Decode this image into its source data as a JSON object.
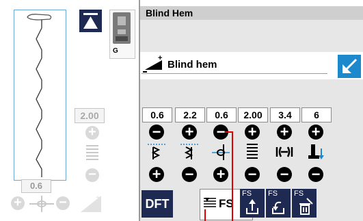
{
  "left_panel": {
    "width_value": "2.00",
    "position_value": "0.6"
  },
  "foot": {
    "label": "G"
  },
  "header": {
    "title": "Blind Hem"
  },
  "stitch": {
    "name": "Blind hem"
  },
  "settings": {
    "values": [
      "0.6",
      "2.2",
      "0.6",
      "2.00",
      "3.4",
      "6"
    ],
    "top_buttons": [
      "−",
      "+",
      "−",
      "+",
      "+",
      "+"
    ],
    "bottom_buttons": [
      "+",
      "−",
      "+",
      "−",
      "−",
      "−"
    ],
    "icons": [
      "left-width-icon",
      "right-width-icon",
      "needle-position-icon",
      "stitch-density-icon",
      "elastic-icon",
      "presser-foot-icon"
    ]
  },
  "bottom_bar": {
    "dft_label": "DFT",
    "fs_label": "FS",
    "fs_buttons": [
      "FS",
      "FS",
      "FS"
    ]
  },
  "colors": {
    "navy": "#1f2a52",
    "accent_blue": "#1e88cc",
    "annotation_red": "#e00000"
  }
}
